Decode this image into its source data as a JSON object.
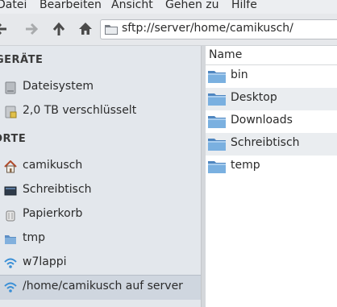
{
  "menubar": {
    "items": [
      "Datei",
      "Bearbeiten",
      "Ansicht",
      "Gehen zu",
      "Hilfe"
    ]
  },
  "toolbar": {
    "back_icon": "back-arrow-icon",
    "forward_icon": "forward-arrow-icon",
    "up_icon": "up-arrow-icon",
    "home_icon": "home-icon"
  },
  "location": {
    "path": "sftp://server/home/camikusch/"
  },
  "sidebar": {
    "sections": [
      {
        "title": "GERÄTE",
        "items": [
          {
            "label": "Dateisystem",
            "icon": "harddisk-icon"
          },
          {
            "label": "2,0 TB verschlüsselt",
            "icon": "encrypted-disk-icon"
          }
        ]
      },
      {
        "title": "ORTE",
        "items": [
          {
            "label": "camikusch",
            "icon": "home-icon"
          },
          {
            "label": "Schreibtisch",
            "icon": "desktop-icon"
          },
          {
            "label": "Papierkorb",
            "icon": "trash-icon"
          },
          {
            "label": "tmp",
            "icon": "folder-icon"
          },
          {
            "label": "w7lappi",
            "icon": "network-icon"
          },
          {
            "label": "/home/camikusch auf server",
            "icon": "network-icon"
          }
        ]
      }
    ]
  },
  "content": {
    "column_header": "Name",
    "rows": [
      "bin",
      "Desktop",
      "Downloads",
      "Schreibtisch",
      "temp"
    ]
  },
  "colors": {
    "folder": "#6fa5d8",
    "home_roof": "#b04a2a",
    "network": "#3a8fd6"
  }
}
